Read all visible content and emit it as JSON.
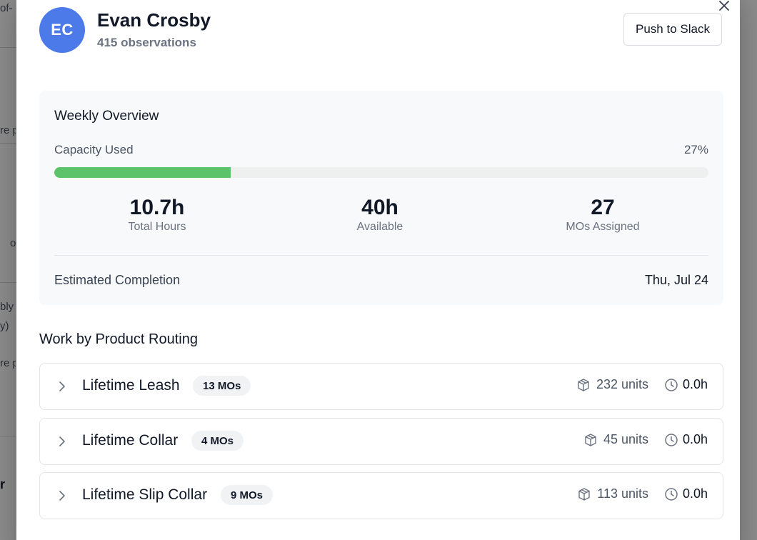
{
  "background": {
    "fragments": [
      "of-",
      "re p",
      "o",
      "bly",
      "y)",
      "re p",
      "r"
    ]
  },
  "modal": {
    "close_icon": "close-icon",
    "user": {
      "initials": "EC",
      "name": "Evan Crosby",
      "observations": "415 observations",
      "avatar_color": "#4c7ae8"
    },
    "push_button_label": "Push to Slack",
    "overview": {
      "title": "Weekly Overview",
      "capacity_label": "Capacity Used",
      "capacity_percent_text": "27%",
      "capacity_fraction": 0.27,
      "progress_color": "#5cc36b",
      "stats": [
        {
          "value": "10.7h",
          "label": "Total Hours"
        },
        {
          "value": "40h",
          "label": "Available"
        },
        {
          "value": "27",
          "label": "MOs Assigned"
        }
      ],
      "estimated_label": "Estimated Completion",
      "estimated_value": "Thu, Jul 24"
    },
    "routing": {
      "title": "Work by Product Routing",
      "rows": [
        {
          "name": "Lifetime Leash",
          "mos": "13 MOs",
          "units": "232 units",
          "hours": "0.0h"
        },
        {
          "name": "Lifetime Collar",
          "mos": "4 MOs",
          "units": "45 units",
          "hours": "0.0h"
        },
        {
          "name": "Lifetime Slip Collar",
          "mos": "9 MOs",
          "units": "113 units",
          "hours": "0.0h"
        }
      ]
    }
  }
}
